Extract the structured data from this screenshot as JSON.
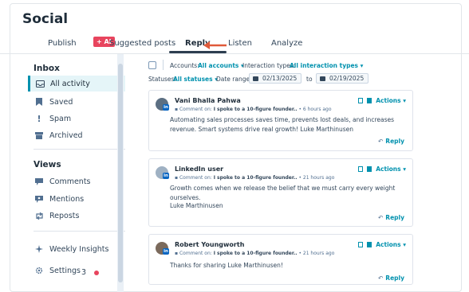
{
  "app": {
    "title": "Social"
  },
  "tabs": [
    {
      "label": "Publish"
    },
    {
      "label": "Suggested posts",
      "badge": "+ AI"
    },
    {
      "label": "Reply",
      "active": true
    },
    {
      "label": "Listen"
    },
    {
      "label": "Analyze"
    }
  ],
  "sidebar": {
    "inbox_heading": "Inbox",
    "inbox_items": [
      {
        "label": "All activity",
        "icon": "inbox-icon",
        "active": true
      },
      {
        "label": "Saved",
        "icon": "bookmark-icon"
      },
      {
        "label": "Spam",
        "icon": "exclamation-icon"
      },
      {
        "label": "Archived",
        "icon": "archive-icon"
      }
    ],
    "views_heading": "Views",
    "views_items": [
      {
        "label": "Comments",
        "icon": "comment-icon"
      },
      {
        "label": "Mentions",
        "icon": "mention-icon"
      },
      {
        "label": "Reposts",
        "icon": "repost-icon"
      }
    ],
    "footer_items": [
      {
        "label": "Weekly Insights",
        "icon": "sparkle-icon"
      },
      {
        "label": "Settings",
        "icon": "gear-icon",
        "count": "3"
      }
    ]
  },
  "filters": {
    "accounts_label": "Accounts:",
    "accounts_value": "All accounts ▾",
    "interaction_label": "Interaction types:",
    "interaction_value": "All interaction types ▾",
    "statuses_label": "Statuses:",
    "statuses_value": "All statuses ▾",
    "date_label": "Date range:",
    "date_from": "02/13/2025",
    "date_to_label": "to",
    "date_to": "02/19/2025"
  },
  "cards": [
    {
      "name": "Vani Bhalla Pahwa",
      "meta_prefix": "Comment on:",
      "meta_post": "I spoke to a 10-figure founder..",
      "meta_time": "• 6 hours ago",
      "body": "Automating sales processes saves time, prevents lost deals, and increases revenue. Smart systems drive real growth! Luke Marthinusen",
      "actions_label": "Actions ▾",
      "reply_label": "Reply"
    },
    {
      "name": "LinkedIn user",
      "meta_prefix": "Comment on:",
      "meta_post": "I spoke to a 10-figure founder..",
      "meta_time": "• 21 hours ago",
      "body": "Growth comes when we release the belief that we must carry every weight ourselves.",
      "body2": "Luke Marthinusen",
      "actions_label": "Actions ▾",
      "reply_label": "Reply"
    },
    {
      "name": "Robert Youngworth",
      "meta_prefix": "Comment on:",
      "meta_post": "I spoke to a 10-figure founder..",
      "meta_time": "• 21 hours ago",
      "body": "Thanks for sharing Luke Marthinusen!",
      "actions_label": "Actions ▾",
      "reply_label": "Reply"
    }
  ],
  "colors": {
    "accent": "#0091ae",
    "ai_badge": "#e8455e",
    "arrow": "#e05a3a",
    "linkedin": "#0a66c2"
  }
}
